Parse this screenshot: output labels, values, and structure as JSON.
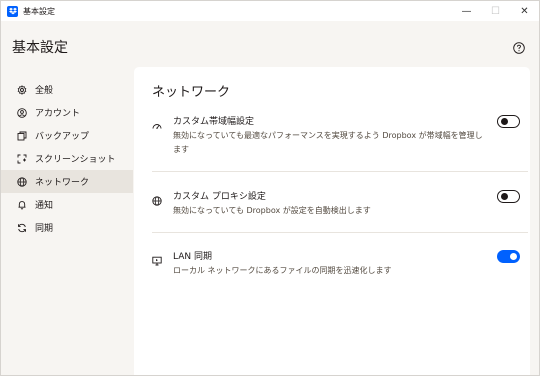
{
  "window": {
    "title": "基本設定",
    "controls": {
      "minimize": "—",
      "maximize": "☐",
      "close": "✕"
    }
  },
  "header": {
    "title": "基本設定"
  },
  "sidebar": {
    "items": [
      {
        "label": "全般",
        "icon": "gear-icon",
        "active": false
      },
      {
        "label": "アカウント",
        "icon": "person-icon",
        "active": false
      },
      {
        "label": "バックアップ",
        "icon": "backup-icon",
        "active": false
      },
      {
        "label": "スクリーンショット",
        "icon": "screenshot-icon",
        "active": false
      },
      {
        "label": "ネットワーク",
        "icon": "globe-icon",
        "active": true
      },
      {
        "label": "通知",
        "icon": "bell-icon",
        "active": false
      },
      {
        "label": "同期",
        "icon": "sync-icon",
        "active": false
      }
    ]
  },
  "main": {
    "section_title": "ネットワーク",
    "settings": [
      {
        "title": "カスタム帯域幅設定",
        "description": "無効になっていても最適なパフォーマンスを実現するよう Dropbox が帯域幅を管理します",
        "icon": "speedometer-icon",
        "enabled": false
      },
      {
        "title": "カスタム プロキシ設定",
        "description": "無効になっていても Dropbox が設定を自動検出します",
        "icon": "globe-icon",
        "enabled": false
      },
      {
        "title": "LAN 同期",
        "description": "ローカル ネットワークにあるファイルの同期を迅速化します",
        "icon": "monitor-icon",
        "enabled": true
      }
    ]
  },
  "colors": {
    "accent": "#0061fe",
    "sidebar_bg": "#f7f5f2",
    "active_item_bg": "#e8e4de",
    "text": "#1e1919"
  }
}
